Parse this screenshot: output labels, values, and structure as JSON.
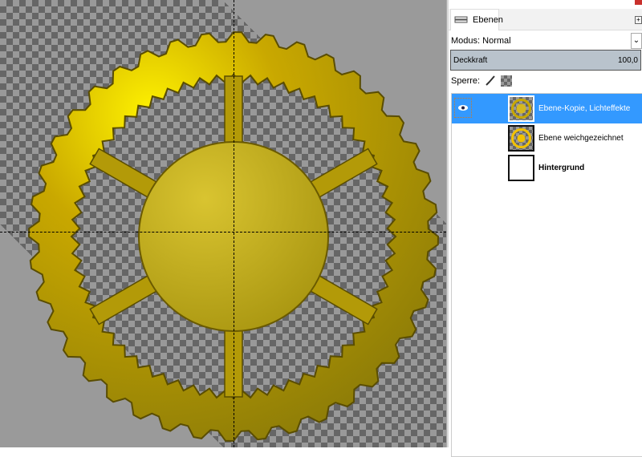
{
  "panel": {
    "tab_label": "Ebenen",
    "mode_label": "Modus: Normal",
    "opacity_label": "Deckkraft",
    "opacity_value": "100,0",
    "lock_label": "Sperre:",
    "layers": [
      {
        "name": "Ebene-Kopie, Lichteffekte",
        "visible": true,
        "selected": true
      },
      {
        "name": "Ebene weichgezeichnet",
        "visible": false,
        "selected": false
      },
      {
        "name": "Hintergrund",
        "visible": false,
        "selected": false
      }
    ]
  },
  "colors": {
    "gear": "#c8a800",
    "selection": "#3399ff"
  }
}
